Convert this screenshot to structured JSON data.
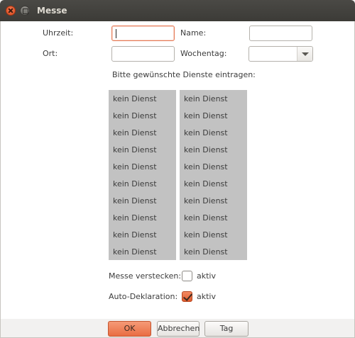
{
  "window": {
    "title": "Messe"
  },
  "form": {
    "uhrzeit_label": "Uhrzeit:",
    "uhrzeit_value": "",
    "name_label": "Name:",
    "name_value": "",
    "ort_label": "Ort:",
    "ort_value": "",
    "wochentag_label": "Wochentag:",
    "wochentag_value": "",
    "instructions": "Bitte gewünschte Dienste eintragen:"
  },
  "services": {
    "left": [
      "kein Dienst",
      "kein Dienst",
      "kein Dienst",
      "kein Dienst",
      "kein Dienst",
      "kein Dienst",
      "kein Dienst",
      "kein Dienst",
      "kein Dienst",
      "kein Dienst"
    ],
    "right": [
      "kein Dienst",
      "kein Dienst",
      "kein Dienst",
      "kein Dienst",
      "kein Dienst",
      "kein Dienst",
      "kein Dienst",
      "kein Dienst",
      "kein Dienst",
      "kein Dienst"
    ]
  },
  "options": {
    "hide_label": "Messe verstecken:",
    "hide_checkbox_label": "aktiv",
    "hide_checked": false,
    "autodecl_label": "Auto-Deklaration:",
    "autodecl_checkbox_label": "aktiv",
    "autodecl_checked": true
  },
  "buttons": {
    "ok": "OK",
    "cancel": "Abbrechen",
    "tag": "Tag"
  },
  "colors": {
    "accent": "#e96d42",
    "list_bg": "#c2c2c2",
    "titlebar": "#3c3b37"
  }
}
